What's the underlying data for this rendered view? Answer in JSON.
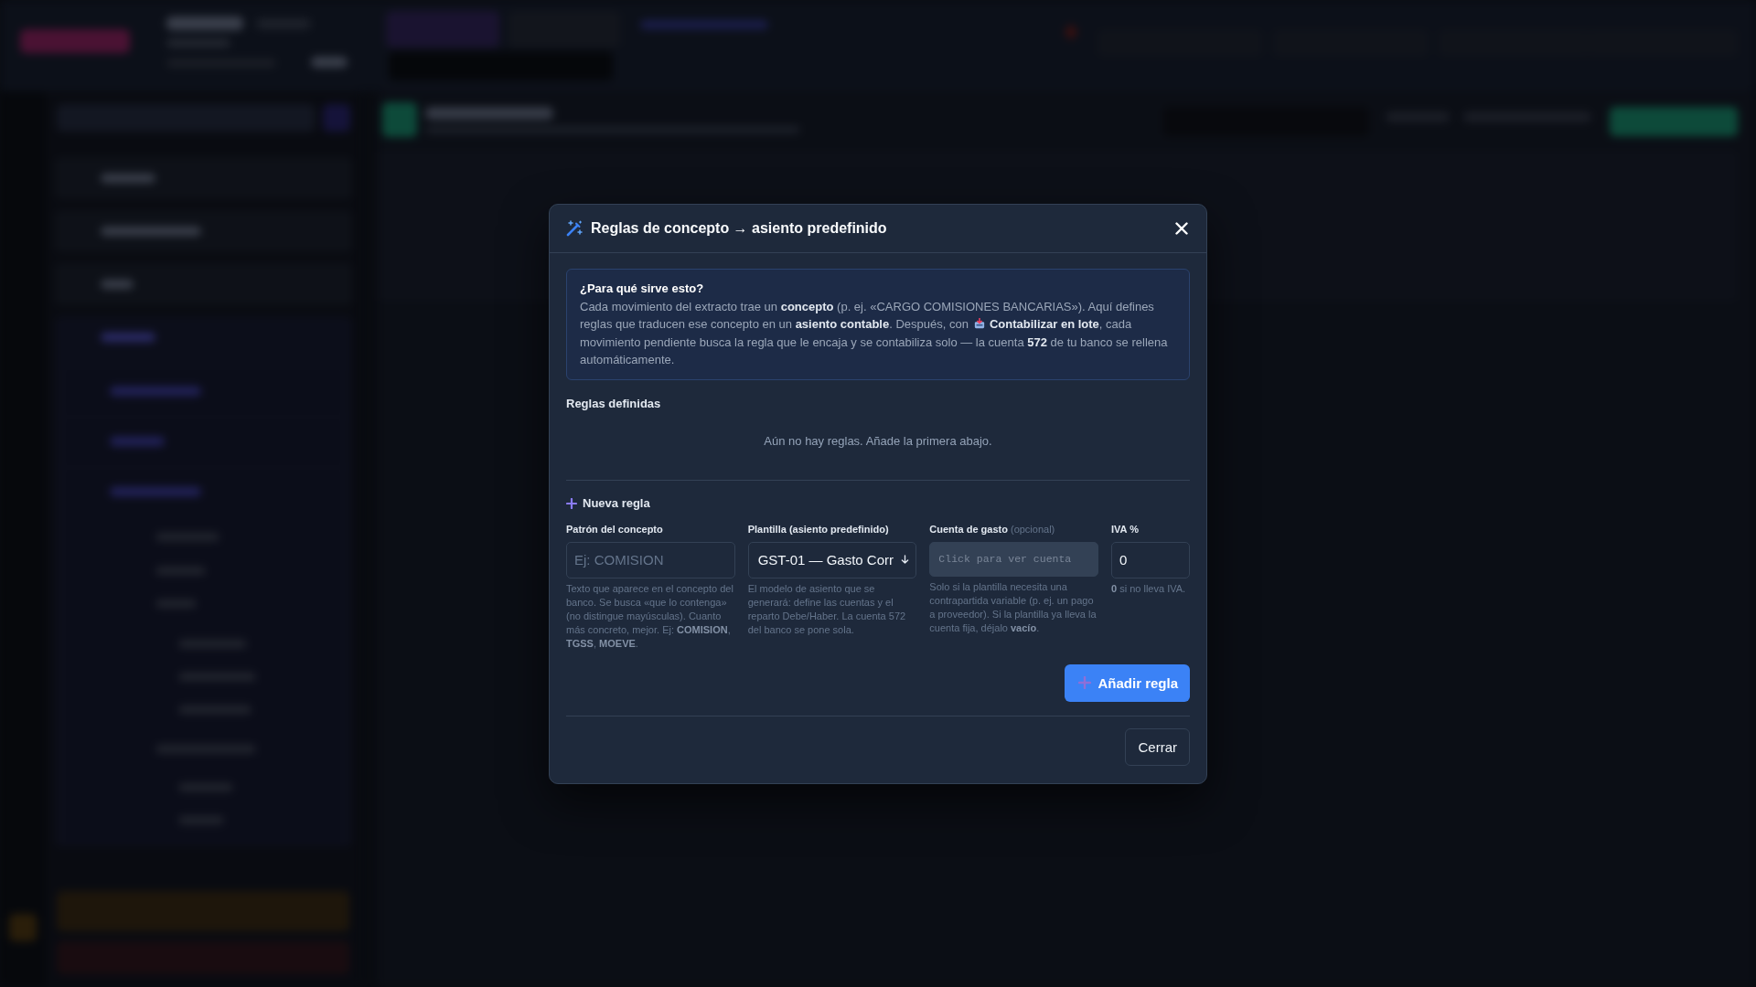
{
  "dialog": {
    "title": "Reglas de concepto → asiento predefinido",
    "info": {
      "heading": "¿Para qué sirve esto?",
      "text_before_icon": "Cada movimiento del extracto trae un **concepto** (p. ej. «CARGO COMISIONES BANCARIAS»). Aquí defines reglas que traducen ese concepto en un **asiento contable**. Después, con",
      "text_after_icon": "**Contabilizar en lote**, cada movimiento pendiente busca la regla que le encaja y se contabiliza solo — la cuenta **572** de tu banco se rellena automáticamente."
    },
    "rules_section": {
      "title": "Reglas definidas",
      "empty_message": "Aún no hay reglas. Añade la primera abajo."
    },
    "new_rule": {
      "title": "Nueva regla",
      "fields": [
        {
          "kind": "text",
          "label": "Patrón del concepto",
          "placeholder": "Ej: COMISION",
          "help": "Texto que aparece en el concepto del banco. Se busca «que lo contenga» (no distingue mayúsculas). Cuanto más concreto, mejor. Ej: **COMISION**, **TGSS**, **MOEVE**."
        },
        {
          "kind": "select",
          "label": "Plantilla (asiento predefinido)",
          "value": "GST-01 — Gasto Corr",
          "help": "El modelo de asiento que se generará: define las cuentas y el reparto Debe/Haber. La cuenta 572 del banco se pone sola."
        },
        {
          "kind": "picker",
          "label": "Cuenta de gasto",
          "note": "(opcional)",
          "placeholder": "Click para ver cuenta",
          "help": "Solo si la plantilla necesita una contrapartida variable (p. ej. un pago a proveedor). Si la plantilla ya lleva la cuenta fija, déjalo **vacío**."
        },
        {
          "kind": "number",
          "label": "IVA %",
          "value": "0",
          "help": "**0** si no lleva IVA."
        }
      ],
      "add_button": "Añadir regla"
    },
    "close_button": "Cerrar"
  }
}
